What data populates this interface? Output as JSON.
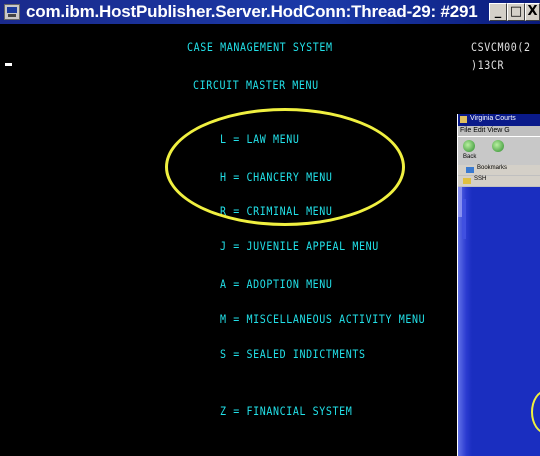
{
  "window": {
    "title": "com.ibm.HostPublisher.Server.HodConn:Thread-29: #291",
    "buttons": {
      "minimize": "_",
      "maximize": "□",
      "close": "X"
    }
  },
  "terminal": {
    "header": "CASE MANAGEMENT SYSTEM",
    "right_line1": "CSVCM00(2",
    "right_line2": ")13CR",
    "menu_title": "CIRCUIT MASTER MENU",
    "cursor": "-",
    "menu_items": [
      {
        "label": "L = LAW MENU"
      },
      {
        "label": "H = CHANCERY MENU"
      },
      {
        "label": "R = CRIMINAL MENU"
      },
      {
        "label": "J = JUVENILE APPEAL MENU"
      },
      {
        "label": "A = ADOPTION MENU"
      },
      {
        "label": "M = MISCELLANEOUS ACTIVITY MENU"
      },
      {
        "label": "S = SEALED INDICTMENTS"
      },
      {
        "label": "Z = FINANCIAL SYSTEM"
      }
    ]
  },
  "overlay_browser": {
    "title": "Virginia Courts",
    "menu": "File  Edit  View  G",
    "back_label": "Back",
    "address_text": "Bookmarks",
    "links_text": "SSH"
  },
  "colors": {
    "terminal_text": "#22e0e8",
    "highlight": "#f0f040",
    "titlebar": "#1a2a8c"
  }
}
